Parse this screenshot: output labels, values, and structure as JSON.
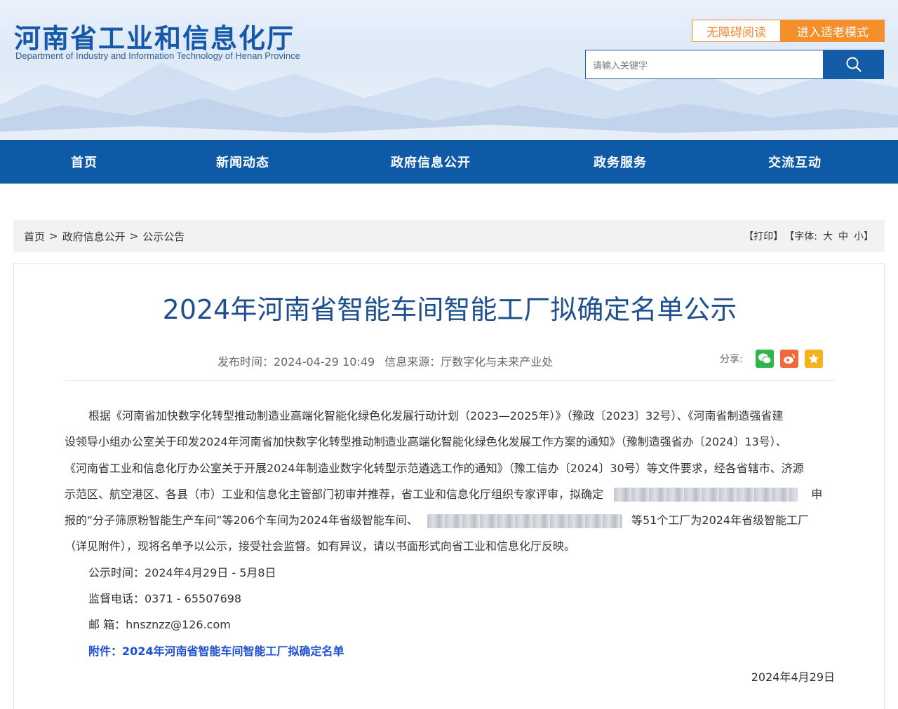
{
  "header": {
    "title": "河南省工业和信息化厅",
    "subtitle": "Department of Industry and Information Technology of Henan Province",
    "accessibility_label": "无障碍阅读",
    "elder_mode_label": "进入适老模式",
    "search_placeholder": "请输入关键字",
    "search_icon": "search-icon"
  },
  "nav": {
    "items": [
      "首页",
      "新闻动态",
      "政府信息公开",
      "政务服务",
      "交流互动"
    ]
  },
  "breadcrumb": {
    "items": [
      "首页",
      "政府信息公开",
      "公示公告"
    ],
    "separator": ">",
    "print": "【打印】",
    "font_label": "【字体:",
    "font_large": "大",
    "font_medium": "中",
    "font_small": "小】"
  },
  "article": {
    "title": "2024年河南省智能车间智能工厂拟确定名单公示",
    "publish_time": "发布时间：2024-04-29 10:49",
    "source": "信息来源：厅数字化与未来产业处",
    "share_label": "分享:",
    "share_icons": [
      "wechat-icon",
      "weibo-icon",
      "favorite-icon"
    ],
    "lines": [
      "根据《河南省加快数字化转型推动制造业高端化智能化绿色化发展行动计划（2023—2025年）》（豫政〔2023〕32号）、《河南省制造强省建",
      "设领导小组办公室关于印发2024年河南省加快数字化转型推动制造业高端化智能化绿色化发展工作方案的通知》（豫制造强省办〔2024〕13号）、",
      "《河南省工业和信息化厅办公室关于开展2024年制造业数字化转型示范遴选工作的通知》（豫工信办〔2024〕30号）等文件要求，经各省辖市、济源",
      "示范区、航空港区、各县（市）工业和信息化主管部门初审并推荐，省工业和信息化厅组织专家评审，拟确定",
      "申",
      "报的“分子筛原粉智能生产车间”等206个车间为2024年省级智能车间、",
      "等51个工厂为2024年省级智能工厂",
      "（详见附件），现将名单予以公示，接受社会监督。如有异议，请以书面形式向省工业和信息化厅反映。"
    ],
    "period": "公示时间：2024年4月29日 - 5月8日",
    "phone": "监督电话：0371 - 65507698",
    "email": "邮 箱：hnsznzz@126.com",
    "attachment": "附件：2024年河南省智能车间智能工厂拟确定名单",
    "date": "2024年4月29日"
  },
  "colors": {
    "brand": "#1659a8",
    "nav_bg": "#0e5aa7",
    "accent_orange": "#f3902c",
    "title": "#1f4f8e",
    "link": "#1c4fd1"
  }
}
